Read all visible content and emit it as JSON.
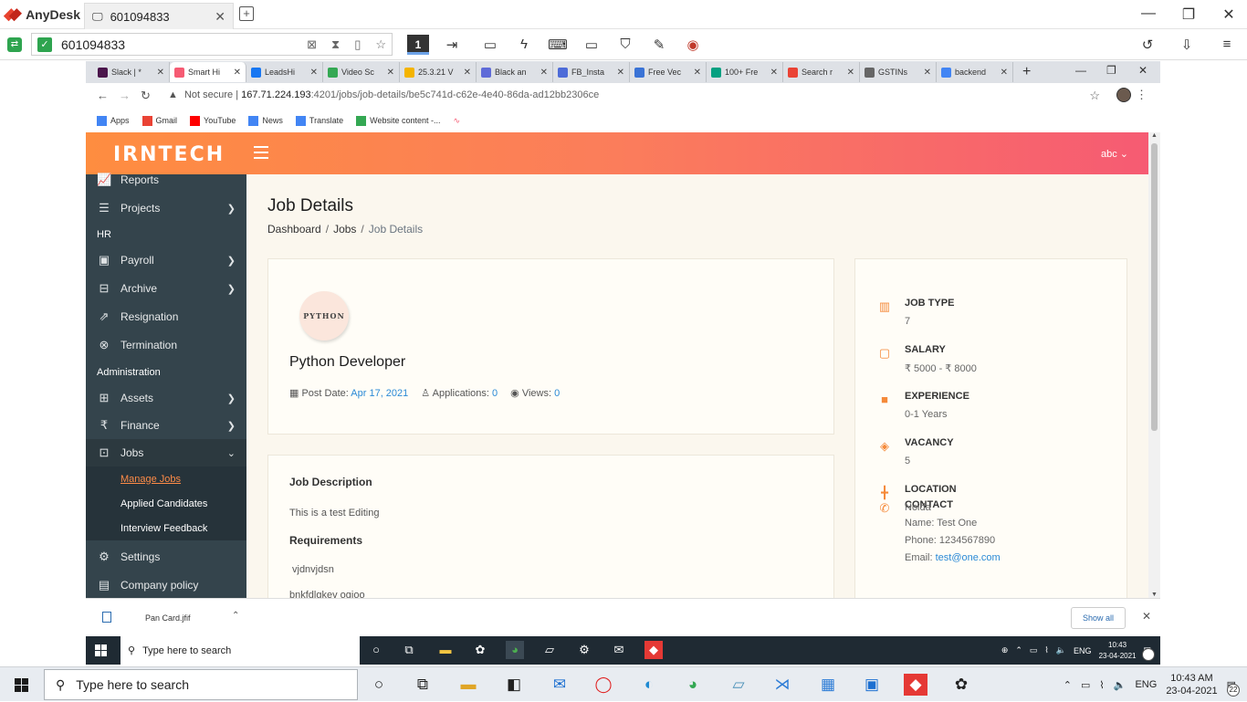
{
  "anydesk": {
    "app_name": "AnyDesk",
    "tab_title": "601094833",
    "address_value": "601094833",
    "monitor_label": "1"
  },
  "chrome": {
    "tabs": [
      {
        "title": "Slack | *",
        "color": "#4a154b"
      },
      {
        "title": "Smart Hi",
        "color": "#f65b73"
      },
      {
        "title": "LeadsHi",
        "color": "#1877f2"
      },
      {
        "title": "Video Sc",
        "color": "#34a853"
      },
      {
        "title": "25.3.21 V",
        "color": "#f4b400"
      },
      {
        "title": "Black an",
        "color": "#5f6bd8"
      },
      {
        "title": "FB_Insta",
        "color": "#4d6bd8"
      },
      {
        "title": "Free Vec",
        "color": "#3a73d6"
      },
      {
        "title": "100+ Fre",
        "color": "#05a081"
      },
      {
        "title": "Search r",
        "color": "#ea4335"
      },
      {
        "title": "GSTINs",
        "color": "#666666"
      },
      {
        "title": "backend",
        "color": "#4285f4"
      }
    ],
    "url_warning": "Not secure",
    "url_host": "167.71.224.193",
    "url_path": ":4201/jobs/job-details/be5c741d-c62e-4e40-86da-ad12bb2306ce",
    "bookmarks": [
      {
        "label": "Apps",
        "color": "#4285f4"
      },
      {
        "label": "Gmail",
        "color": "#ea4335"
      },
      {
        "label": "YouTube",
        "color": "#ff0000"
      },
      {
        "label": "News",
        "color": "#4285f4"
      },
      {
        "label": "Translate",
        "color": "#4285f4"
      },
      {
        "label": "Website content -...",
        "color": "#34a853"
      }
    ]
  },
  "app": {
    "brand": "IRNTECH",
    "user_menu": "abc",
    "sidebar": {
      "items_top": [
        {
          "label": "Reports",
          "icon": "chart-line-icon",
          "glyph": "📈",
          "chevron": false
        },
        {
          "label": "Projects",
          "icon": "layers-icon",
          "glyph": "☰",
          "chevron": true
        }
      ],
      "section_hr": "HR",
      "items_hr": [
        {
          "label": "Payroll",
          "icon": "wallet-icon",
          "glyph": "▣",
          "chevron": true
        },
        {
          "label": "Archive",
          "icon": "archive-icon",
          "glyph": "⊟",
          "chevron": true
        },
        {
          "label": "Resignation",
          "icon": "exit-icon",
          "glyph": "⇗",
          "chevron": false
        },
        {
          "label": "Termination",
          "icon": "cancel-circle-icon",
          "glyph": "⊗",
          "chevron": false
        }
      ],
      "section_admin": "Administration",
      "items_admin": [
        {
          "label": "Assets",
          "icon": "assets-icon",
          "glyph": "⊞",
          "chevron": true
        },
        {
          "label": "Finance",
          "icon": "rupee-icon",
          "glyph": "₹",
          "chevron": true
        }
      ],
      "jobs": {
        "label": "Jobs",
        "icon": "briefcase-icon",
        "glyph": "⊡"
      },
      "jobs_sub": [
        "Manage Jobs",
        "Applied Candidates",
        "Interview Feedback"
      ],
      "items_bottom": [
        {
          "label": "Settings",
          "icon": "gear-icon",
          "glyph": "⚙"
        },
        {
          "label": "Company policy",
          "icon": "document-icon",
          "glyph": "▤"
        }
      ]
    },
    "page_title": "Job Details",
    "breadcrumb": [
      "Dashboard",
      "Jobs",
      "Job Details"
    ],
    "job": {
      "logo_text": "PYTHON",
      "title": "Python Developer",
      "post_date_label": "Post Date:",
      "post_date": "Apr 17, 2021",
      "applications_label": "Applications:",
      "applications": "0",
      "views_label": "Views:",
      "views": "0"
    },
    "description": {
      "heading": "Job Description",
      "text": "This is a test Editing",
      "req_heading": "Requirements",
      "req_1": "vjdnvjdsn",
      "req_2": "bnkfdlgkev ogjoo"
    },
    "info": [
      {
        "label": "JOB TYPE",
        "value": "7",
        "icon": "bar-chart-icon",
        "glyph": "▥"
      },
      {
        "label": "SALARY",
        "value": "₹ 5000 - ₹ 8000",
        "icon": "money-icon",
        "glyph": "▢"
      },
      {
        "label": "EXPERIENCE",
        "value": "0-1 Years",
        "icon": "suitcase-icon",
        "glyph": "■"
      },
      {
        "label": "VACANCY",
        "value": "5",
        "icon": "ticket-icon",
        "glyph": "◈"
      },
      {
        "label": "LOCATION",
        "value": "Noida",
        "icon": "signpost-icon",
        "glyph": "╋"
      }
    ],
    "contact": {
      "label": "CONTACT",
      "name": "Name: Test One",
      "phone": "Phone: 1234567890",
      "email_label": "Email: ",
      "email": "test@one.com"
    }
  },
  "download_bar": {
    "file": "Pan Card.jfif",
    "show_all": "Show all"
  },
  "remote_taskbar": {
    "search_placeholder": "Type here to search",
    "lang": "ENG",
    "time": "10:43",
    "date": "23-04-2021",
    "notifications": "22"
  },
  "host_taskbar": {
    "search_placeholder": "Type here to search",
    "lang": "ENG",
    "time": "10:43 AM",
    "date": "23-04-2021",
    "notifications": "22"
  }
}
